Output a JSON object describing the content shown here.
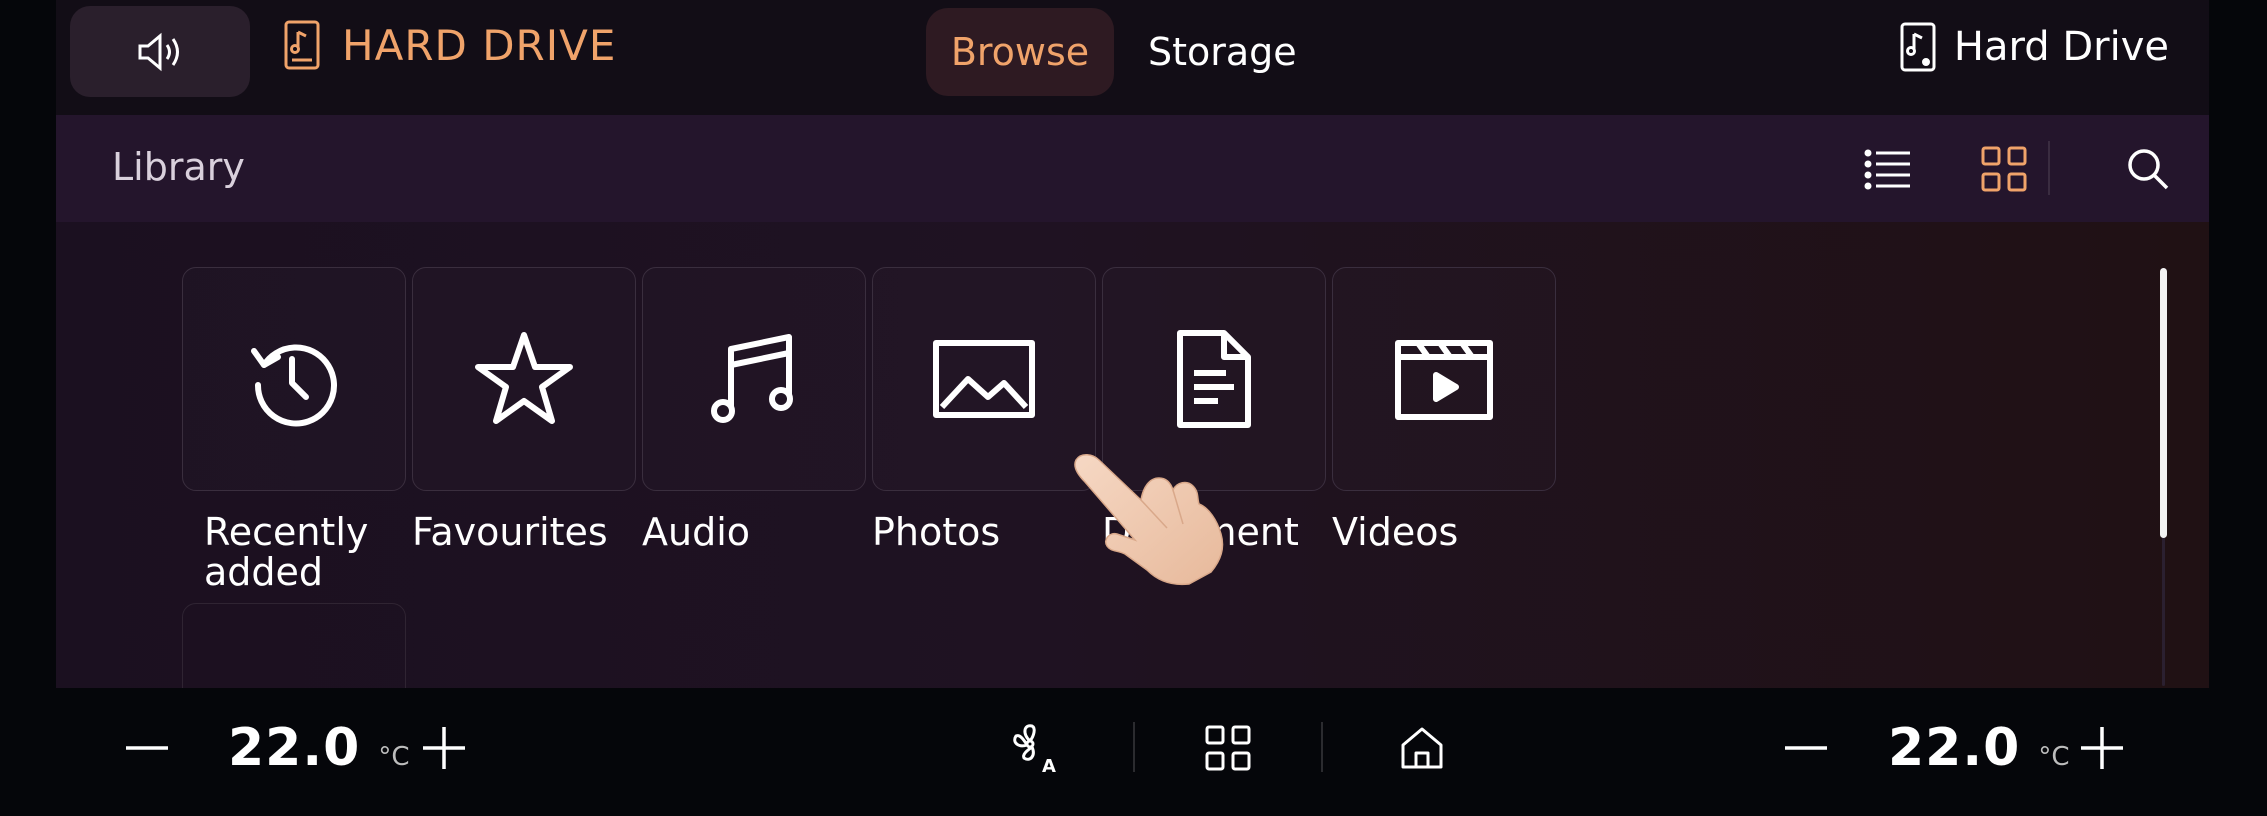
{
  "header": {
    "title": "HARD DRIVE",
    "tabs": [
      {
        "label": "Browse",
        "active": true
      },
      {
        "label": "Storage",
        "active": false
      }
    ],
    "device_label": "Hard Drive",
    "icons": {
      "volume": "volume-icon",
      "music_file": "music-file-icon",
      "device": "hard-drive-icon"
    }
  },
  "library": {
    "label": "Library",
    "tools": [
      "list-view-icon",
      "grid-view-icon",
      "search-icon"
    ]
  },
  "categories": [
    {
      "label_line1": "Recently",
      "label_line2": "added",
      "icon": "history-icon"
    },
    {
      "label_line1": "Favourites",
      "label_line2": "",
      "icon": "star-icon"
    },
    {
      "label_line1": "Audio",
      "label_line2": "",
      "icon": "music-note-icon"
    },
    {
      "label_line1": "Photos",
      "label_line2": "",
      "icon": "image-icon"
    },
    {
      "label_line1": "Document",
      "label_line2": "",
      "icon": "document-icon"
    },
    {
      "label_line1": "Videos",
      "label_line2": "",
      "icon": "video-icon"
    }
  ],
  "climate": {
    "left_temp": "22.0",
    "right_temp": "22.0",
    "unit": "°C",
    "center_icons": [
      "fan-auto-icon",
      "apps-grid-icon",
      "home-icon"
    ]
  },
  "colors": {
    "accent": "#f0a36a",
    "background": "#1b1020",
    "libbar": "#24152c"
  }
}
